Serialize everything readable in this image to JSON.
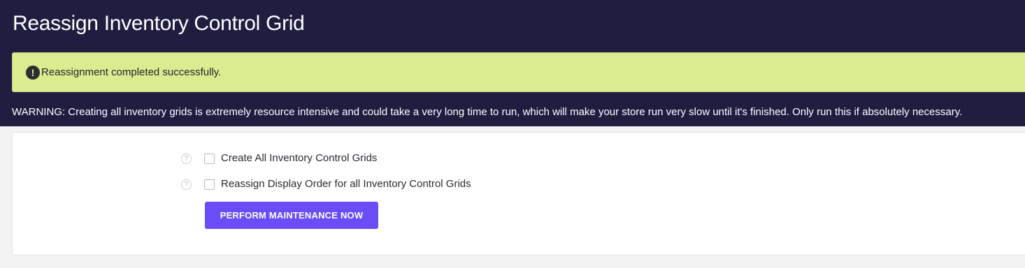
{
  "header": {
    "title": "Reassign Inventory Control Grid"
  },
  "alert": {
    "icon": "exclamation-circle-icon",
    "icon_glyph": "!",
    "message": "Reassignment completed successfully."
  },
  "warning": {
    "text": "WARNING: Creating all inventory grids is extremely resource intensive and could take a very long time to run, which will make your store run very slow until it's finished. Only run this if absolutely necessary."
  },
  "form": {
    "options": [
      {
        "label": "Create All Inventory Control Grids",
        "checked": false,
        "help_icon": "question-circle-icon",
        "help_glyph": "?"
      },
      {
        "label": "Reassign Display Order for all Inventory Control Grids",
        "checked": false,
        "help_icon": "question-circle-icon",
        "help_glyph": "?"
      }
    ],
    "submit_label": "PERFORM MAINTENANCE NOW"
  },
  "colors": {
    "header_bg": "#211d41",
    "alert_bg": "#d9ec90",
    "button_bg": "#6b4cf6",
    "page_bg": "#f3f3f4"
  }
}
